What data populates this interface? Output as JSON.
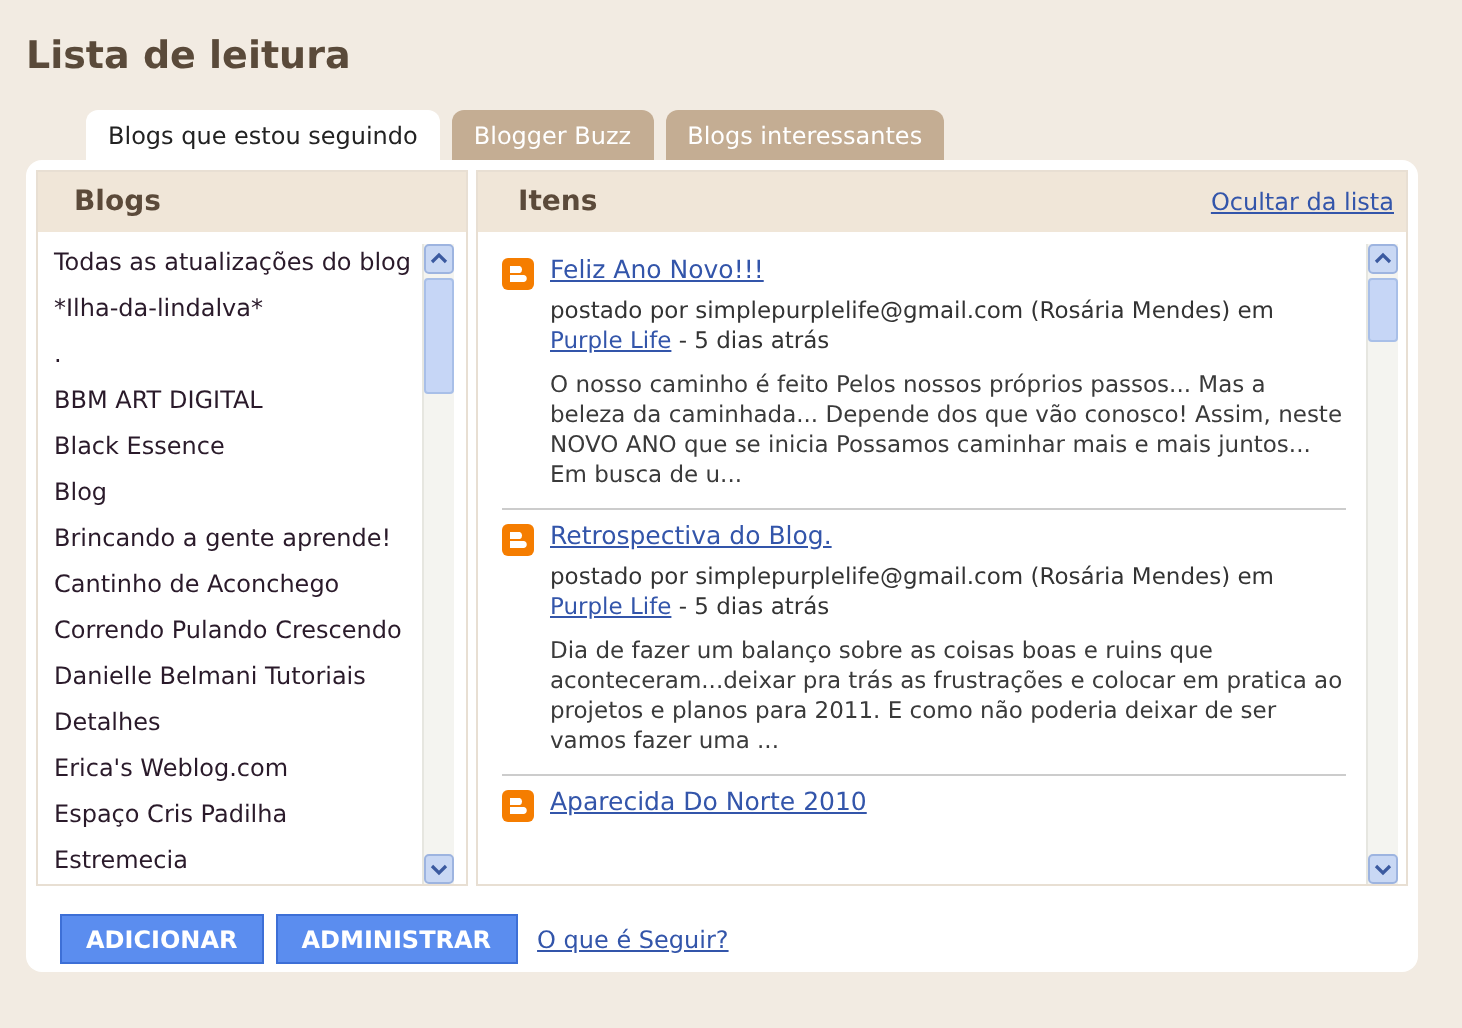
{
  "page_title": "Lista de leitura",
  "tabs": [
    {
      "label": "Blogs que estou seguindo",
      "selected": true
    },
    {
      "label": "Blogger Buzz",
      "selected": false
    },
    {
      "label": "Blogs interessantes",
      "selected": false
    }
  ],
  "blogs_panel": {
    "heading": "Blogs",
    "items": [
      "Todas as atualizações do blog",
      "*Ilha-da-lindalva*",
      ".",
      "BBM ART DIGITAL",
      "Black Essence",
      "Blog",
      "Brincando a gente aprende!",
      "Cantinho de Aconchego",
      "Correndo Pulando Crescendo",
      "Danielle Belmani Tutoriais",
      "Detalhes",
      "Erica's Weblog.com",
      "Espaço Cris Padilha",
      "Estremecia"
    ]
  },
  "items_panel": {
    "heading": "Itens",
    "hide_link": "Ocultar da lista",
    "posts": [
      {
        "title": "Feliz Ano Novo!!!",
        "byline": "postado por simplepurplelife@gmail.com (Rosária Mendes) em ",
        "blog_link": "Purple Life",
        "age": " - 5 dias atrás",
        "excerpt": "O nosso caminho é feito Pelos nossos próprios passos... Mas a beleza da caminhada... Depende dos que vão conosco! Assim, neste NOVO ANO que se inicia Possamos caminhar mais e mais juntos... Em busca de u..."
      },
      {
        "title": "Retrospectiva do Blog.",
        "byline": "postado por simplepurplelife@gmail.com (Rosária Mendes) em ",
        "blog_link": "Purple Life",
        "age": " - 5 dias atrás",
        "excerpt": "Dia de fazer um balanço sobre as coisas boas e ruins que aconteceram...deixar pra trás as frustrações e colocar em pratica ao projetos e planos para 2011. E como não poderia deixar de ser vamos fazer uma ..."
      },
      {
        "title": "Aparecida Do Norte 2010"
      }
    ]
  },
  "buttons": [
    "ADICIONAR",
    "ADMINISTRAR"
  ],
  "help_link": "O que é Seguir?"
}
